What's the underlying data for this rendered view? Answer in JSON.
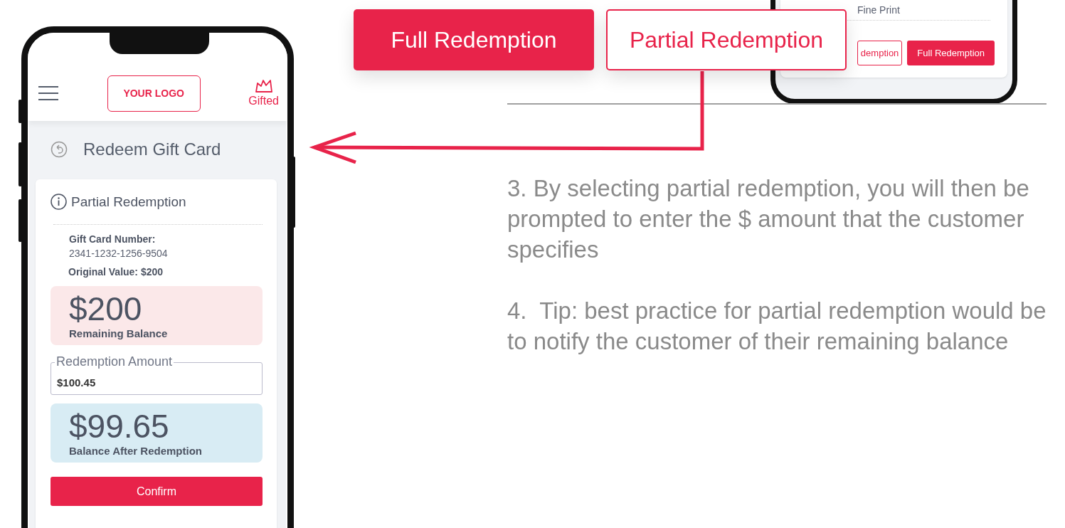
{
  "callout_buttons": [
    {
      "label": "Full Redemption",
      "kind": "filled"
    },
    {
      "label": "Partial Redemption",
      "kind": "outlined"
    }
  ],
  "background_phone": {
    "link": "Fine Print",
    "buttons": [
      {
        "label": "demption",
        "kind": "outlined"
      },
      {
        "label": "Full Redemption",
        "kind": "filled"
      }
    ]
  },
  "phone": {
    "header": {
      "logo": "YOUR LOGO",
      "brand": "Gifted"
    },
    "page_title": "Redeem Gift Card",
    "card": {
      "title": "Partial Redemption",
      "card_number_label": "Gift Card Number:",
      "card_number": "2341-1232-1256-9504",
      "original_value": "Original Value: $200",
      "remaining": {
        "amount": "$200",
        "label": "Remaining Balance"
      },
      "redemption_field": {
        "label": "Redemption Amount",
        "value": "$100.45"
      },
      "after": {
        "amount": "$99.65",
        "label": "Balance After Redemption"
      },
      "confirm": "Confirm"
    }
  },
  "instructions": [
    "3. By selecting partial redemption, you will then be prompted to enter the $ amount that the customer specifies",
    "4.  Tip: best practice for partial redemption would be to notify the customer of their remaining balance"
  ]
}
